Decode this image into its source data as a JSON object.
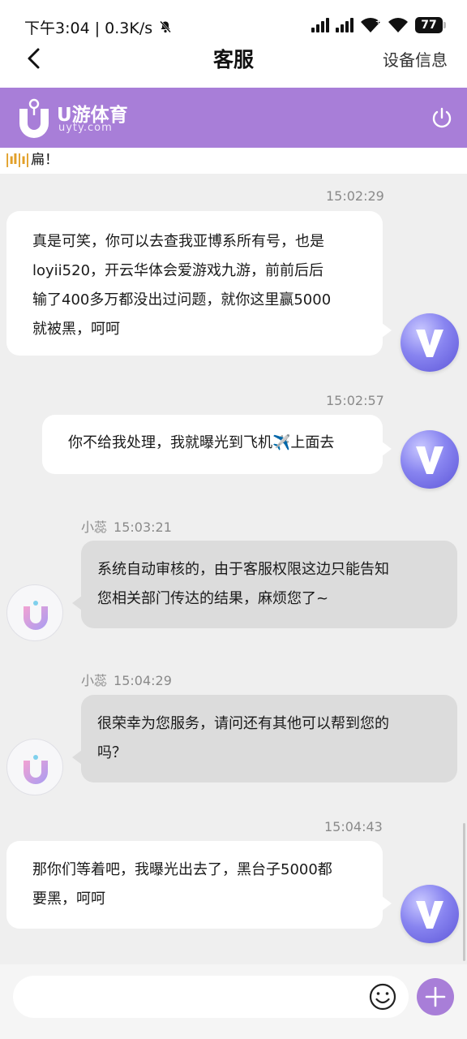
{
  "status_bar": {
    "time": "下午3:04",
    "network_speed": "0.3K/s",
    "separator": "|",
    "battery": "77"
  },
  "nav": {
    "title": "客服",
    "right_action": "设备信息"
  },
  "brand": {
    "name": "U游体育",
    "domain": "uyty.com",
    "color": "#a87ed8"
  },
  "marquee": {
    "text": "扁！"
  },
  "messages": [
    {
      "direction": "outgoing",
      "time": "15:02:29",
      "lines": [
        "真是可笑，你可以去查我亚博系所有号，也是",
        "loyii520，开云华体会爱游戏九游，前前后后",
        "输了400多万都没出过问题，就你这里赢5000",
        "就被黑，呵呵"
      ]
    },
    {
      "direction": "outgoing",
      "time": "15:02:57",
      "lines": [
        "你不给我处理，我就曝光到飞机✈️上面去"
      ]
    },
    {
      "direction": "incoming",
      "sender": "小蕊",
      "time": "15:03:21",
      "lines": [
        "系统自动审核的，由于客服权限这边只能告知",
        "您相关部门传达的结果，麻烦您了~"
      ]
    },
    {
      "direction": "incoming",
      "sender": "小蕊",
      "time": "15:04:29",
      "lines": [
        "很荣幸为您服务，请问还有其他可以帮到您的",
        "吗？"
      ]
    },
    {
      "direction": "outgoing",
      "time": "15:04:43",
      "lines": [
        "那你们等着吧，我曝光出去了，黑台子5000都",
        "要黑，呵呵"
      ]
    }
  ],
  "input": {
    "placeholder": ""
  }
}
